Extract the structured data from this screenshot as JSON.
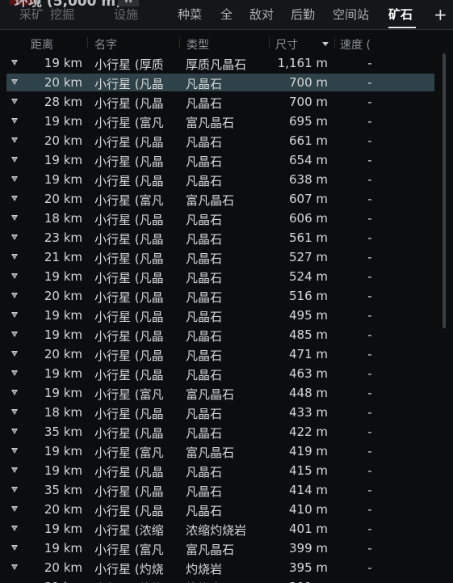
{
  "window": {
    "title": "环境 (5,000 m)",
    "title_badge": "W"
  },
  "tabs": [
    {
      "label": "采矿",
      "state": "faded"
    },
    {
      "label": "挖掘",
      "state": "faded"
    },
    {
      "label": "设施",
      "state": "faded"
    },
    {
      "label": "种菜",
      "state": "normal"
    },
    {
      "label": "全",
      "state": "normal"
    },
    {
      "label": "敌对",
      "state": "normal"
    },
    {
      "label": "后勤",
      "state": "normal"
    },
    {
      "label": "空间站",
      "state": "normal"
    },
    {
      "label": "矿石",
      "state": "active"
    }
  ],
  "add_tab_label": "+",
  "columns": {
    "distance": "距离",
    "name": "名字",
    "type": "类型",
    "size": "尺寸",
    "velocity": "速度 ("
  },
  "icons": {
    "row": "asteroid-icon",
    "sort": "sort-descending-icon"
  },
  "colors": {
    "selected_row": "#2d4249",
    "background": "#0b0d0f",
    "text": "#d6d8da"
  },
  "rows": [
    {
      "distance": "19 km",
      "name": "小行星 (厚质",
      "type": "厚质凡晶石",
      "size": "1,161 m",
      "velocity": "-"
    },
    {
      "distance": "20 km",
      "name": "小行星 (凡晶",
      "type": "凡晶石",
      "size": "700 m",
      "velocity": "-",
      "selected": true
    },
    {
      "distance": "28 km",
      "name": "小行星 (凡晶",
      "type": "凡晶石",
      "size": "700 m",
      "velocity": "-"
    },
    {
      "distance": "19 km",
      "name": "小行星 (富凡",
      "type": "富凡晶石",
      "size": "695 m",
      "velocity": "-"
    },
    {
      "distance": "20 km",
      "name": "小行星 (凡晶",
      "type": "凡晶石",
      "size": "661 m",
      "velocity": "-"
    },
    {
      "distance": "19 km",
      "name": "小行星 (凡晶",
      "type": "凡晶石",
      "size": "654 m",
      "velocity": "-"
    },
    {
      "distance": "19 km",
      "name": "小行星 (凡晶",
      "type": "凡晶石",
      "size": "638 m",
      "velocity": "-"
    },
    {
      "distance": "20 km",
      "name": "小行星 (富凡",
      "type": "富凡晶石",
      "size": "607 m",
      "velocity": "-"
    },
    {
      "distance": "18 km",
      "name": "小行星 (凡晶",
      "type": "凡晶石",
      "size": "606 m",
      "velocity": "-"
    },
    {
      "distance": "23 km",
      "name": "小行星 (凡晶",
      "type": "凡晶石",
      "size": "561 m",
      "velocity": "-"
    },
    {
      "distance": "21 km",
      "name": "小行星 (凡晶",
      "type": "凡晶石",
      "size": "527 m",
      "velocity": "-"
    },
    {
      "distance": "19 km",
      "name": "小行星 (凡晶",
      "type": "凡晶石",
      "size": "524 m",
      "velocity": "-"
    },
    {
      "distance": "20 km",
      "name": "小行星 (凡晶",
      "type": "凡晶石",
      "size": "516 m",
      "velocity": "-"
    },
    {
      "distance": "19 km",
      "name": "小行星 (凡晶",
      "type": "凡晶石",
      "size": "495 m",
      "velocity": "-"
    },
    {
      "distance": "19 km",
      "name": "小行星 (凡晶",
      "type": "凡晶石",
      "size": "485 m",
      "velocity": "-"
    },
    {
      "distance": "20 km",
      "name": "小行星 (凡晶",
      "type": "凡晶石",
      "size": "471 m",
      "velocity": "-"
    },
    {
      "distance": "19 km",
      "name": "小行星 (凡晶",
      "type": "凡晶石",
      "size": "463 m",
      "velocity": "-"
    },
    {
      "distance": "19 km",
      "name": "小行星 (富凡",
      "type": "富凡晶石",
      "size": "448 m",
      "velocity": "-"
    },
    {
      "distance": "18 km",
      "name": "小行星 (凡晶",
      "type": "凡晶石",
      "size": "433 m",
      "velocity": "-"
    },
    {
      "distance": "35 km",
      "name": "小行星 (凡晶",
      "type": "凡晶石",
      "size": "422 m",
      "velocity": "-"
    },
    {
      "distance": "19 km",
      "name": "小行星 (富凡",
      "type": "富凡晶石",
      "size": "419 m",
      "velocity": "-"
    },
    {
      "distance": "19 km",
      "name": "小行星 (凡晶",
      "type": "凡晶石",
      "size": "415 m",
      "velocity": "-"
    },
    {
      "distance": "35 km",
      "name": "小行星 (凡晶",
      "type": "凡晶石",
      "size": "414 m",
      "velocity": "-"
    },
    {
      "distance": "20 km",
      "name": "小行星 (凡晶",
      "type": "凡晶石",
      "size": "410 m",
      "velocity": "-"
    },
    {
      "distance": "19 km",
      "name": "小行星 (浓缩",
      "type": "浓缩灼烧岩",
      "size": "401 m",
      "velocity": "-"
    },
    {
      "distance": "19 km",
      "name": "小行星 (富凡",
      "type": "富凡晶石",
      "size": "399 m",
      "velocity": "-"
    },
    {
      "distance": "20 km",
      "name": "小行星 (灼烧",
      "type": "灼烧岩",
      "size": "395 m",
      "velocity": "-"
    },
    {
      "distance": "21 km",
      "name": "小行星 (灼烧",
      "type": "灼烧岩",
      "size": "391 m",
      "velocity": "-"
    }
  ]
}
